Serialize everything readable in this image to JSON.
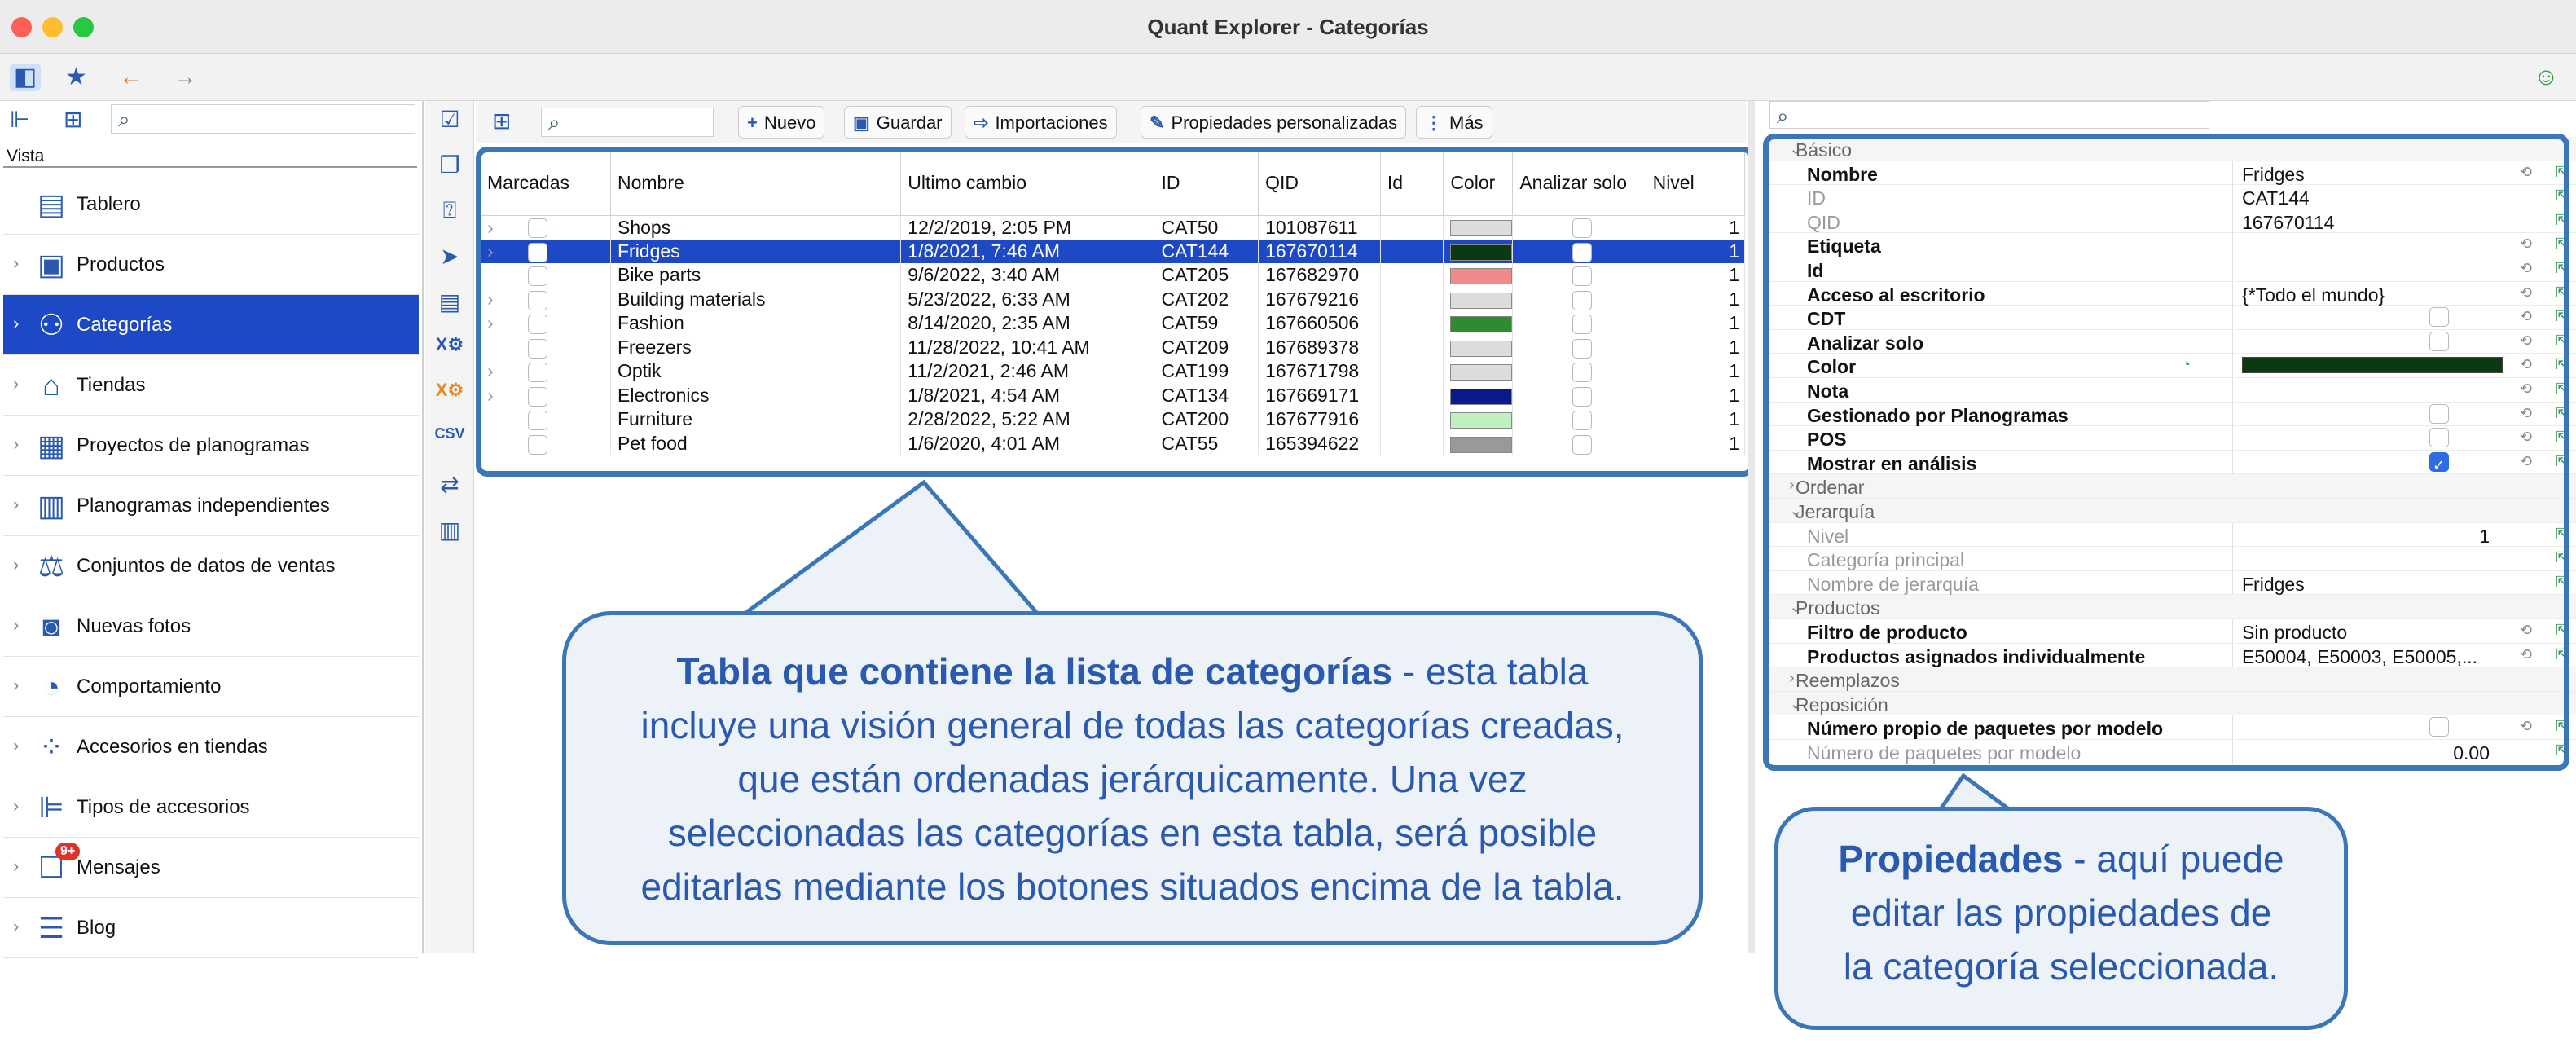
{
  "window": {
    "title": "Quant Explorer - Categorías"
  },
  "left": {
    "vista_label": "Vista",
    "nav": [
      {
        "label": "Tablero",
        "icon": "dashboard-icon",
        "glyph": "▤"
      },
      {
        "label": "Productos",
        "icon": "product-icon",
        "glyph": "▣"
      },
      {
        "label": "Categorías",
        "icon": "categories-icon",
        "glyph": "⚇"
      },
      {
        "label": "Tiendas",
        "icon": "store-icon",
        "glyph": "⌂"
      },
      {
        "label": "Proyectos de planogramas",
        "icon": "planogram-project-icon",
        "glyph": "▦"
      },
      {
        "label": "Planogramas independientes",
        "icon": "planogram-icon",
        "glyph": "▥"
      },
      {
        "label": "Conjuntos de datos de ventas",
        "icon": "sales-data-icon",
        "glyph": "⚖"
      },
      {
        "label": "Nuevas fotos",
        "icon": "camera-icon",
        "glyph": "◙"
      },
      {
        "label": "Comportamiento",
        "icon": "behavior-icon",
        "glyph": "◔"
      },
      {
        "label": "Accesorios en tiendas",
        "icon": "store-accessories-icon",
        "glyph": "⁘"
      },
      {
        "label": "Tipos de accesorios",
        "icon": "accessory-types-icon",
        "glyph": "⊫"
      },
      {
        "label": "Mensajes",
        "icon": "messages-icon",
        "glyph": "☐",
        "badge": "9+"
      },
      {
        "label": "Blog",
        "icon": "blog-icon",
        "glyph": "☰"
      }
    ]
  },
  "toolbar": {
    "nuevo": "Nuevo",
    "guardar": "Guardar",
    "importaciones": "Importaciones",
    "propiedades": "Propiedades personalizadas",
    "mas": "Más"
  },
  "table": {
    "columns": [
      "Marcadas",
      "Nombre",
      "Ultimo cambio",
      "ID",
      "QID",
      "Id",
      "Color",
      "Analizar solo",
      "Nivel"
    ],
    "rows": [
      {
        "nombre": "Shops",
        "cambio": "12/2/2019, 2:05 PM",
        "id": "CAT50",
        "qid": "101087611",
        "nivel": "1",
        "color": "#dcdcdc",
        "exp": true
      },
      {
        "nombre": "Fridges",
        "cambio": "1/8/2021, 7:46 AM",
        "id": "CAT144",
        "qid": "167670114",
        "nivel": "1",
        "color": "#0b3a12",
        "exp": true,
        "sel": true
      },
      {
        "nombre": "Bike parts",
        "cambio": "9/6/2022, 3:40 AM",
        "id": "CAT205",
        "qid": "167682970",
        "nivel": "1",
        "color": "#f08a8a",
        "exp": false
      },
      {
        "nombre": "Building materials",
        "cambio": "5/23/2022, 6:33 AM",
        "id": "CAT202",
        "qid": "167679216",
        "nivel": "1",
        "color": "#dcdcdc",
        "exp": true
      },
      {
        "nombre": "Fashion",
        "cambio": "8/14/2020, 2:35 AM",
        "id": "CAT59",
        "qid": "167660506",
        "nivel": "1",
        "color": "#2e8b2e",
        "exp": true
      },
      {
        "nombre": "Freezers",
        "cambio": "11/28/2022, 10:41 AM",
        "id": "CAT209",
        "qid": "167689378",
        "nivel": "1",
        "color": "#dcdcdc",
        "exp": false
      },
      {
        "nombre": "Optik",
        "cambio": "11/2/2021, 2:46 AM",
        "id": "CAT199",
        "qid": "167671798",
        "nivel": "1",
        "color": "#dcdcdc",
        "exp": true
      },
      {
        "nombre": "Electronics",
        "cambio": "1/8/2021, 4:54 AM",
        "id": "CAT134",
        "qid": "167669171",
        "nivel": "1",
        "color": "#0a1a8a",
        "exp": true
      },
      {
        "nombre": "Furniture",
        "cambio": "2/28/2022, 5:22 AM",
        "id": "CAT200",
        "qid": "167677916",
        "nivel": "1",
        "color": "#bff0bf",
        "exp": false
      },
      {
        "nombre": "Pet food",
        "cambio": "1/6/2020, 4:01 AM",
        "id": "CAT55",
        "qid": "165394622",
        "nivel": "1",
        "color": "#999999",
        "exp": false
      }
    ]
  },
  "props": [
    {
      "t": "group",
      "n": "Básico"
    },
    {
      "n": "Nombre",
      "v": "Fridges",
      "b": true
    },
    {
      "n": "ID",
      "v": "CAT144",
      "dim": true
    },
    {
      "n": "QID",
      "v": "167670114",
      "dim": true
    },
    {
      "n": "Etiqueta",
      "v": "",
      "b": true
    },
    {
      "n": "Id",
      "v": "",
      "b": true
    },
    {
      "n": "Acceso al escritorio",
      "v": "{*Todo el mundo}",
      "b": true
    },
    {
      "n": "CDT",
      "v": "",
      "b": true,
      "cb": "off"
    },
    {
      "n": "Analizar solo",
      "v": "",
      "b": true,
      "cb": "off"
    },
    {
      "n": "Color",
      "v": "",
      "b": true,
      "color": "#0b3a12"
    },
    {
      "n": "Nota",
      "v": "",
      "b": true
    },
    {
      "n": "Gestionado por Planogramas",
      "v": "",
      "b": true,
      "cb": "off"
    },
    {
      "n": "POS",
      "v": "",
      "b": true,
      "cb": "off"
    },
    {
      "n": "Mostrar en análisis",
      "v": "",
      "b": true,
      "cb": "on"
    },
    {
      "t": "group",
      "n": "Ordenar",
      "collapsed": true
    },
    {
      "t": "group",
      "n": "Jerarquía"
    },
    {
      "n": "Nivel",
      "v": "1",
      "dim": true,
      "right": true
    },
    {
      "n": "Categoría principal",
      "v": "",
      "dim": true
    },
    {
      "n": "Nombre de jerarquía",
      "v": "Fridges",
      "dim": true
    },
    {
      "t": "group",
      "n": "Productos"
    },
    {
      "n": "Filtro de producto",
      "v": "Sin producto",
      "b": true
    },
    {
      "n": "Productos asignados individualmente",
      "v": "E50004, E50003, E50005,...",
      "b": true
    },
    {
      "t": "group",
      "n": "Reemplazos",
      "collapsed": true
    },
    {
      "t": "group",
      "n": "Reposición"
    },
    {
      "n": "Número propio de paquetes por modelo",
      "v": "",
      "b": true,
      "cb": "off"
    },
    {
      "n": "Número de paquetes por modelo",
      "v": "0.00",
      "dim": true,
      "right": true
    }
  ],
  "callouts": {
    "table_title": "Tabla que contiene la lista de categorías",
    "table_text_1": " - esta tabla",
    "table_text_2": "incluye una visión general de todas las categorías creadas,",
    "table_text_3": "que están ordenadas jerárquicamente. Una vez",
    "table_text_4": "seleccionadas las categorías en esta tabla, será posible",
    "table_text_5": "editarlas mediante los botones situados encima de la tabla.",
    "props_title": "Propiedades",
    "props_text_1": " - aquí puede",
    "props_text_2": "editar las propiedades de",
    "props_text_3": "la categoría seleccionada."
  }
}
